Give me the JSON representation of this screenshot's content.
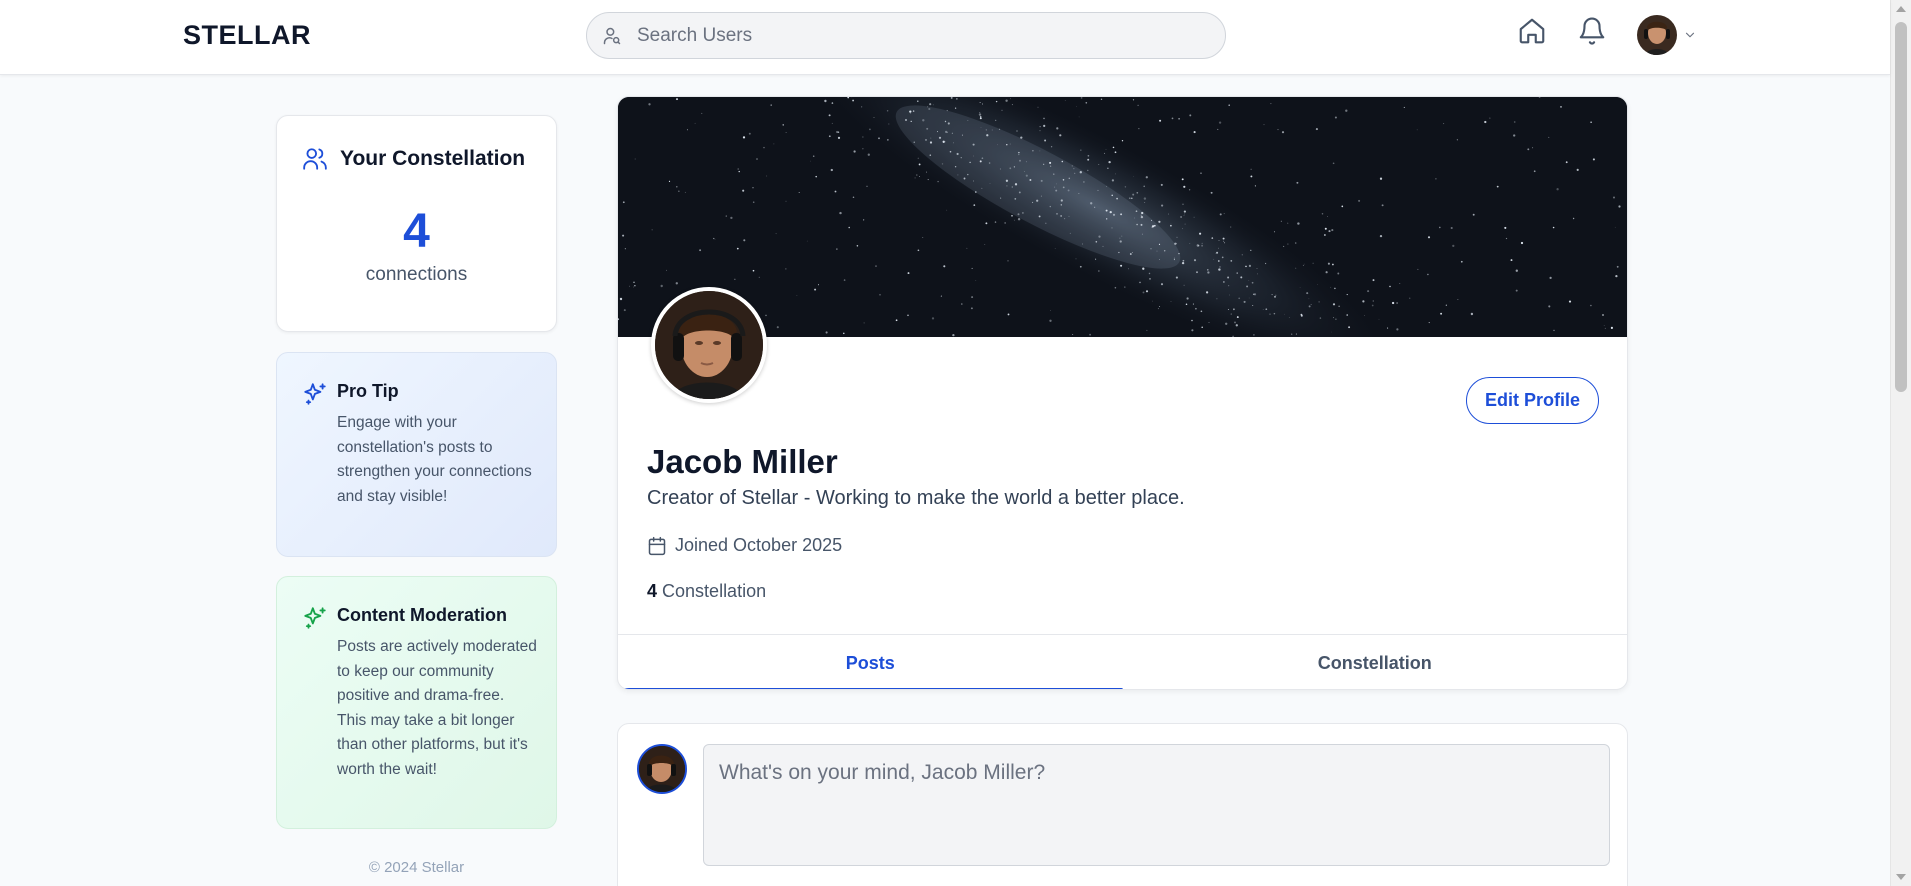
{
  "app": {
    "brand": "STELLAR"
  },
  "search": {
    "placeholder": "Search Users"
  },
  "nav": {
    "home_icon": "home-icon",
    "notifications_icon": "bell-icon",
    "menu_icon": "chevron-down-icon"
  },
  "sidebar": {
    "constellation": {
      "title": "Your Constellation",
      "count": "4",
      "label": "connections",
      "icon": "users-icon"
    },
    "pro_tip": {
      "title": "Pro Tip",
      "body": "Engage with your constellation's posts to strengthen your connections and stay visible!",
      "icon": "sparkles-icon",
      "accent": "#1d4ed8"
    },
    "moderation": {
      "title": "Content Moderation",
      "body": "Posts are actively moderated to keep our community positive and drama-free. This may take a bit longer than other platforms, but it's worth the wait!",
      "icon": "sparkles-icon",
      "accent": "#16a34a"
    },
    "footer": "© 2024 Stellar"
  },
  "profile": {
    "name": "Jacob Miller",
    "bio": "Creator of Stellar - Working to make the world a better place.",
    "joined": "Joined October 2025",
    "constellation_count": "4",
    "constellation_label": "Constellation",
    "edit_label": "Edit Profile",
    "tabs": [
      {
        "label": "Posts",
        "active": true
      },
      {
        "label": "Constellation",
        "active": false
      }
    ]
  },
  "composer": {
    "placeholder": "What's on your mind, Jacob Miller?"
  },
  "colors": {
    "accent": "#1d4ed8",
    "background": "#f8fafc"
  }
}
